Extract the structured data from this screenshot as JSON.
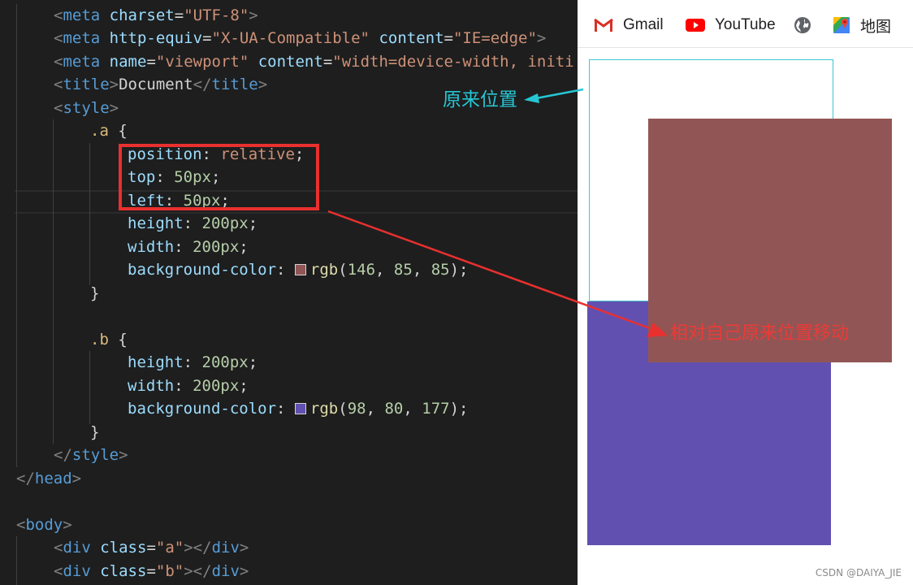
{
  "editor": {
    "line1": {
      "open": "<",
      "tag": "meta",
      "sp": " ",
      "attr": "charset",
      "eq": "=",
      "val": "\"UTF-8\"",
      "close": ">"
    },
    "line2": {
      "open": "<",
      "tag": "meta",
      "sp": " ",
      "attr1": "http-equiv",
      "eq": "=",
      "val1": "\"X-UA-Compatible\"",
      "attr2": "content",
      "val2": "\"IE=edge\"",
      "close": ">"
    },
    "line3": {
      "open": "<",
      "tag": "meta",
      "sp": " ",
      "attr1": "name",
      "eq": "=",
      "val1": "\"viewport\"",
      "attr2": "content",
      "val2": "\"width=device-width, initi"
    },
    "line4": {
      "open": "<",
      "tag": "title",
      "close": ">",
      "text": "Document",
      "endopen": "</",
      "endclose": ">"
    },
    "line5": {
      "open": "<",
      "tag": "style",
      "close": ">"
    },
    "line6": {
      "selector": ".a",
      "brace": " {"
    },
    "line7": {
      "prop": "position",
      "colon": ": ",
      "val": "relative",
      "semi": ";"
    },
    "line8": {
      "prop": "top",
      "colon": ": ",
      "val": "50px",
      "semi": ";"
    },
    "line9": {
      "prop": "left",
      "colon": ": ",
      "val": "50px",
      "semi": ";"
    },
    "line10": {
      "prop": "height",
      "colon": ": ",
      "val": "200px",
      "semi": ";"
    },
    "line11": {
      "prop": "width",
      "colon": ": ",
      "val": "200px",
      "semi": ";"
    },
    "line12": {
      "prop": "background-color",
      "colon": ": ",
      "fn": "rgb",
      "args_open": "(",
      "n1": "146",
      ",1": ", ",
      "n2": "85",
      ",2": ", ",
      "n3": "85",
      "args_close": ")",
      "semi": ";",
      "swatch": "#925555"
    },
    "line13": {
      "brace": "}"
    },
    "line15": {
      "selector": ".b",
      "brace": " {"
    },
    "line16": {
      "prop": "height",
      "colon": ": ",
      "val": "200px",
      "semi": ";"
    },
    "line17": {
      "prop": "width",
      "colon": ": ",
      "val": "200px",
      "semi": ";"
    },
    "line18": {
      "prop": "background-color",
      "colon": ": ",
      "fn": "rgb",
      "args_open": "(",
      "n1": "98",
      ",1": ", ",
      "n2": "80",
      ",2": ", ",
      "n3": "177",
      "args_close": ")",
      "semi": ";",
      "swatch": "#6250b1"
    },
    "line19": {
      "brace": "}"
    },
    "line20": {
      "open": "</",
      "tag": "style",
      "close": ">"
    },
    "line21": {
      "open": "</",
      "tag": "head",
      "close": ">"
    },
    "line23": {
      "open": "<",
      "tag": "body",
      "close": ">"
    },
    "line24": {
      "open": "<",
      "tag": "div",
      "sp": " ",
      "attr": "class",
      "eq": "=",
      "val": "\"a\"",
      "close": ">",
      "endopen": "</",
      "endclose": ">"
    },
    "line25": {
      "open": "<",
      "tag": "div",
      "sp": " ",
      "attr": "class",
      "eq": "=",
      "val": "\"b\"",
      "close": ">",
      "endopen": "</",
      "endclose": ">"
    }
  },
  "bookmarks": [
    {
      "label": "Gmail",
      "icon": "gmail-icon"
    },
    {
      "label": "YouTube",
      "icon": "youtube-icon"
    },
    {
      "label": "",
      "icon": "globe-icon"
    },
    {
      "label": "地图",
      "icon": "maps-icon"
    }
  ],
  "annotations": {
    "original_position": "原来位置",
    "relative_move": "相对自己原来位置移动"
  },
  "colors": {
    "box_a": "#925555",
    "box_b": "#6250b1",
    "original_outline": "#3ec6d3",
    "annotation_red": "#e8302f",
    "annotation_cyan": "#26c6d4"
  },
  "watermark": "CSDN @DAIYA_JIE"
}
